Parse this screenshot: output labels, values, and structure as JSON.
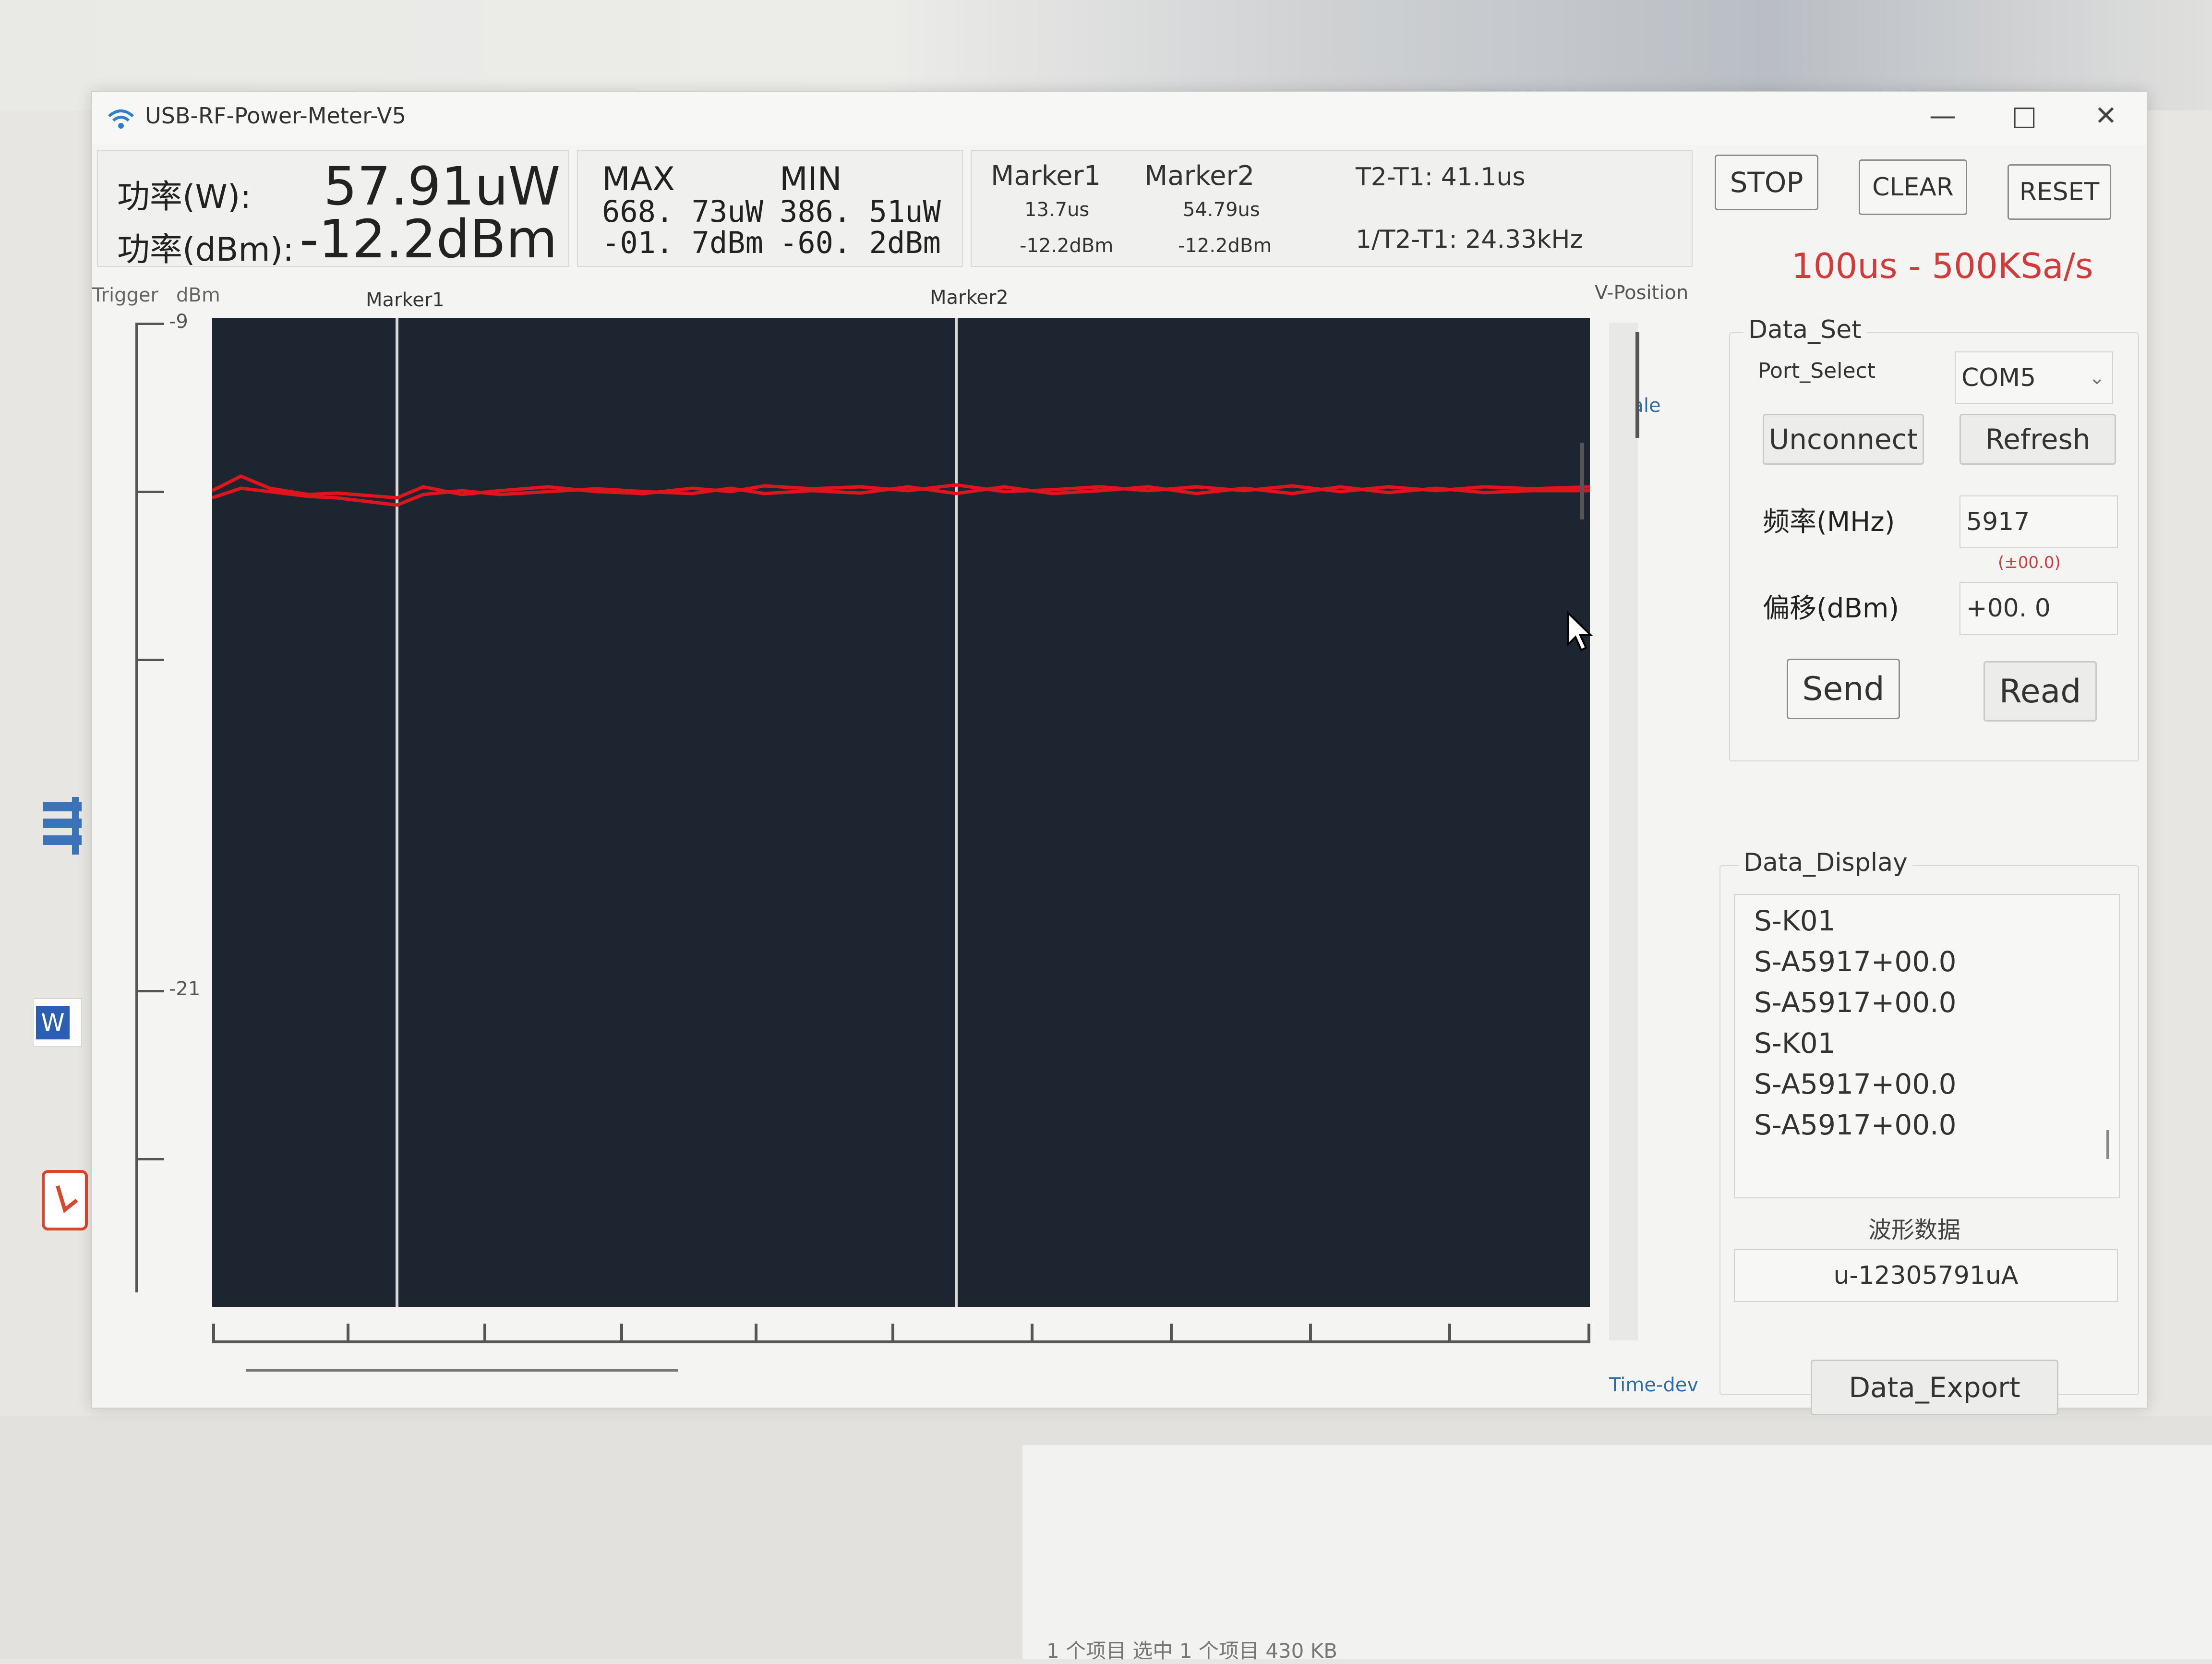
{
  "window": {
    "title": "USB-RF-Power-Meter-V5"
  },
  "readout": {
    "power_w_label": "功率(W):",
    "power_w_value": "57.91uW",
    "power_dbm_label": "功率(dBm):",
    "power_dbm_value": "-12.2dBm"
  },
  "extremes": {
    "max_label": "MAX",
    "max_w": "668. 73uW",
    "max_dbm": "-01. 7dBm",
    "min_label": "MIN",
    "min_w": "386. 51uW",
    "min_dbm": "-60. 2dBm"
  },
  "markers": {
    "marker1_label": "Marker1",
    "marker1_time": "13.7us",
    "marker1_value": "-12.2dBm",
    "marker2_label": "Marker2",
    "marker2_time": "54.79us",
    "marker2_value": "-12.2dBm",
    "delta_t": "T2-T1: 41.1us",
    "delta_f": "1/T2-T1: 24.33kHz"
  },
  "controls": {
    "stop": "STOP",
    "clear": "CLEAR",
    "reset": "RESET",
    "rate": "100us - 500KSa/s"
  },
  "plot": {
    "trigger_label": "Trigger",
    "unit_label": "dBm",
    "marker1_top_label": "Marker1",
    "marker2_top_label": "Marker2",
    "vposition_label": "V-Position",
    "scale_label": "Scale",
    "timedev_label": "Time-dev",
    "y_tick_top": "-9",
    "y_tick_mid": "-21"
  },
  "data_set": {
    "title": "Data_Set",
    "port_label": "Port_Select",
    "port_value": "COM5",
    "unconnect": "Unconnect",
    "refresh": "Refresh",
    "freq_label": "频率(MHz)",
    "freq_value": "5917",
    "freq_hint": "(±00.0)",
    "offset_label": "偏移(dBm)",
    "offset_value": "+00. 0",
    "send": "Send",
    "read": "Read"
  },
  "data_display": {
    "title": "Data_Display",
    "lines": [
      "S-K01",
      "S-A5917+00.0",
      "S-A5917+00.0",
      "S-K01",
      "S-A5917+00.0",
      "S-A5917+00.0"
    ],
    "wave_label": "波形数据",
    "wave_value": "u-12305791uA",
    "export": "Data_Export"
  },
  "status_bar": "1 个项目    选中 1 个项目  430 KB",
  "colors": {
    "trace": "#e0141c",
    "plot_bg": "#1d2630",
    "rate_text": "#d33a3a"
  },
  "icons": [
    "wifi-icon",
    "minimize-icon",
    "maximize-icon",
    "close-icon",
    "dropdown-icon",
    "cursor-icon"
  ]
}
